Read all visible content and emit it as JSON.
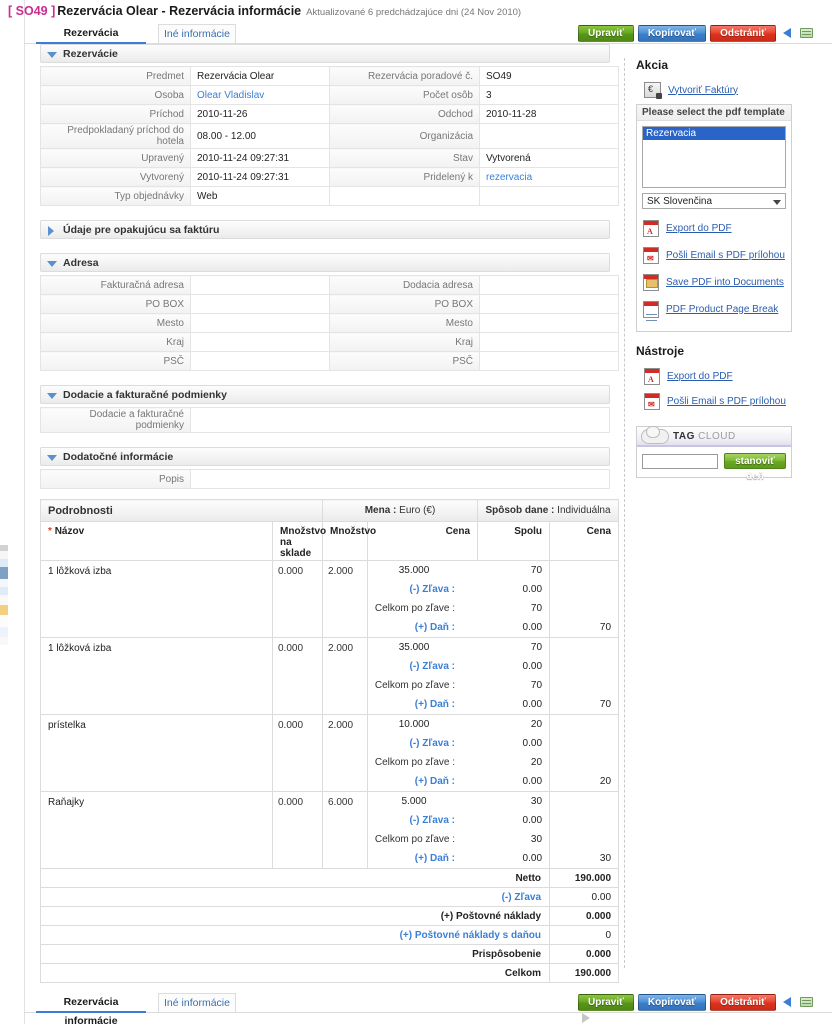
{
  "header": {
    "code": "[ SO49 ]",
    "title": "Rezervácia Olear - Rezervácia informácie",
    "subtitle": "Aktualizované 6 predchádzajúce dni (24 Nov 2010)"
  },
  "tabs": {
    "active": "Rezervácia informácie",
    "inactive": "Iné informácie"
  },
  "toolbar": {
    "edit": "Upraviť",
    "copy": "Kopírovať",
    "delete": "Odstrániť",
    "prev_icon": "previous-arrow-icon",
    "list_icon": "list-view-icon",
    "next_icon": "next-arrow-icon"
  },
  "sections": {
    "reservations": {
      "title": "Rezervácie",
      "rows": [
        {
          "l1": "Predmet",
          "v1": "Rezervácia Olear",
          "l2": "Rezervácia poradové č.",
          "v2": "SO49"
        },
        {
          "l1": "Osoba",
          "v1": "Olear Vladislav",
          "v1_link": true,
          "l2": "Počet osôb",
          "v2": "3"
        },
        {
          "l1": "Príchod",
          "v1": "2010-11-26",
          "l2": "Odchod",
          "v2": "2010-11-28"
        },
        {
          "l1": "Predpokladaný príchod do hotela",
          "v1": "08.00 - 12.00",
          "l2": "Organizácia",
          "v2": ""
        },
        {
          "l1": "Upravený",
          "v1": "2010-11-24 09:27:31",
          "l2": "Stav",
          "v2": "Vytvorená"
        },
        {
          "l1": "Vytvorený",
          "v1": "2010-11-24 09:27:31",
          "l2": "Pridelený k",
          "v2": "rezervacia",
          "v2_link": true
        },
        {
          "l1": "Typ objednávky",
          "v1": "Web",
          "l2": "",
          "v2": "",
          "half": true
        }
      ]
    },
    "recurring": {
      "title": "Údaje pre opakujúcu sa faktúru",
      "collapsed": true
    },
    "address": {
      "title": "Adresa",
      "rows": [
        {
          "l1": "Fakturačná adresa",
          "v1": "",
          "l2": "Dodacia adresa",
          "v2": ""
        },
        {
          "l1": "PO BOX",
          "v1": "",
          "l2": "PO BOX",
          "v2": ""
        },
        {
          "l1": "Mesto",
          "v1": "",
          "l2": "Mesto",
          "v2": ""
        },
        {
          "l1": "Kraj",
          "v1": "",
          "l2": "Kraj",
          "v2": ""
        },
        {
          "l1": "PSČ",
          "v1": "",
          "l2": "PSČ",
          "v2": ""
        }
      ]
    },
    "terms": {
      "title": "Dodacie a fakturačné podmienky",
      "label": "Dodacie a fakturačné podmienky",
      "value": ""
    },
    "additional": {
      "title": "Dodatočné informácie",
      "label": "Popis",
      "value": ""
    }
  },
  "details": {
    "title": "Podrobnosti",
    "currency_label": "Mena :",
    "currency_value": "Euro (€)",
    "tax_label": "Spôsob dane :",
    "tax_value": "Individuálna",
    "columns": {
      "name": "Názov",
      "stock": "Množstvo na skladé",
      "stock_l1": "Množstvo na",
      "stock_l2": "sklade",
      "qty": "Množstvo",
      "price": "Cena",
      "total": "Spolu",
      "line_total": "Cena"
    },
    "sub_labels": {
      "discount": "(-) Zľava :",
      "after_discount": "Celkom po zľave :",
      "tax": "(+) Daň :"
    },
    "items": [
      {
        "name": "1 lôžková izba",
        "stock": "0.000",
        "qty": "2.000",
        "price": "35.000",
        "total": "70",
        "discount": "0.00",
        "after_discount": "70",
        "tax": "0.00",
        "line_total": "70"
      },
      {
        "name": "1 lôžková izba",
        "stock": "0.000",
        "qty": "2.000",
        "price": "35.000",
        "total": "70",
        "discount": "0.00",
        "after_discount": "70",
        "tax": "0.00",
        "line_total": "70"
      },
      {
        "name": "prístelka",
        "stock": "0.000",
        "qty": "2.000",
        "price": "10.000",
        "total": "20",
        "discount": "0.00",
        "after_discount": "20",
        "tax": "0.00",
        "line_total": "20"
      },
      {
        "name": "Raňajky",
        "stock": "0.000",
        "qty": "6.000",
        "price": "5.000",
        "total": "30",
        "discount": "0.00",
        "after_discount": "30",
        "tax": "0.00",
        "line_total": "30"
      }
    ],
    "totals": [
      {
        "label": "Netto",
        "value": "190.000",
        "bold": true
      },
      {
        "label": "(-) Zľava",
        "value": "0.00",
        "blue": true
      },
      {
        "label": "(+) Poštovné náklady",
        "value": "0.000",
        "bold": true
      },
      {
        "label": "(+) Poštovné náklady s daňou",
        "value": "0",
        "blue": true
      },
      {
        "label": "Prispôsobenie",
        "value": "0.000",
        "bold": true
      },
      {
        "label": "Celkom",
        "value": "190.000",
        "bold": true
      }
    ]
  },
  "sidebar": {
    "action_title": "Akcia",
    "create_invoice": "Vytvoriť Faktúry",
    "pdf_panel": {
      "header": "Please select the pdf template",
      "selected_template": "Rezervacia",
      "language": "SK Slovenčina",
      "links": [
        {
          "label": "Export do PDF",
          "icon": "pdf-export-icon"
        },
        {
          "label": "Pošli Email s PDF prílohou",
          "icon": "pdf-email-icon"
        },
        {
          "label": "Save PDF into Documents",
          "icon": "pdf-save-icon"
        },
        {
          "label": "PDF Product Page Break",
          "icon": "pdf-pagebreak-icon"
        }
      ]
    },
    "tools_title": "Nástroje",
    "tools_links": [
      {
        "label": "Export do PDF",
        "icon": "pdf-export-icon"
      },
      {
        "label": "Pošli Email s PDF prílohou",
        "icon": "pdf-email-icon"
      }
    ],
    "tag_cloud": {
      "title_bold": "TAG",
      "title_light": "CLOUD",
      "input_value": "",
      "button": "stanoviť deň"
    }
  }
}
